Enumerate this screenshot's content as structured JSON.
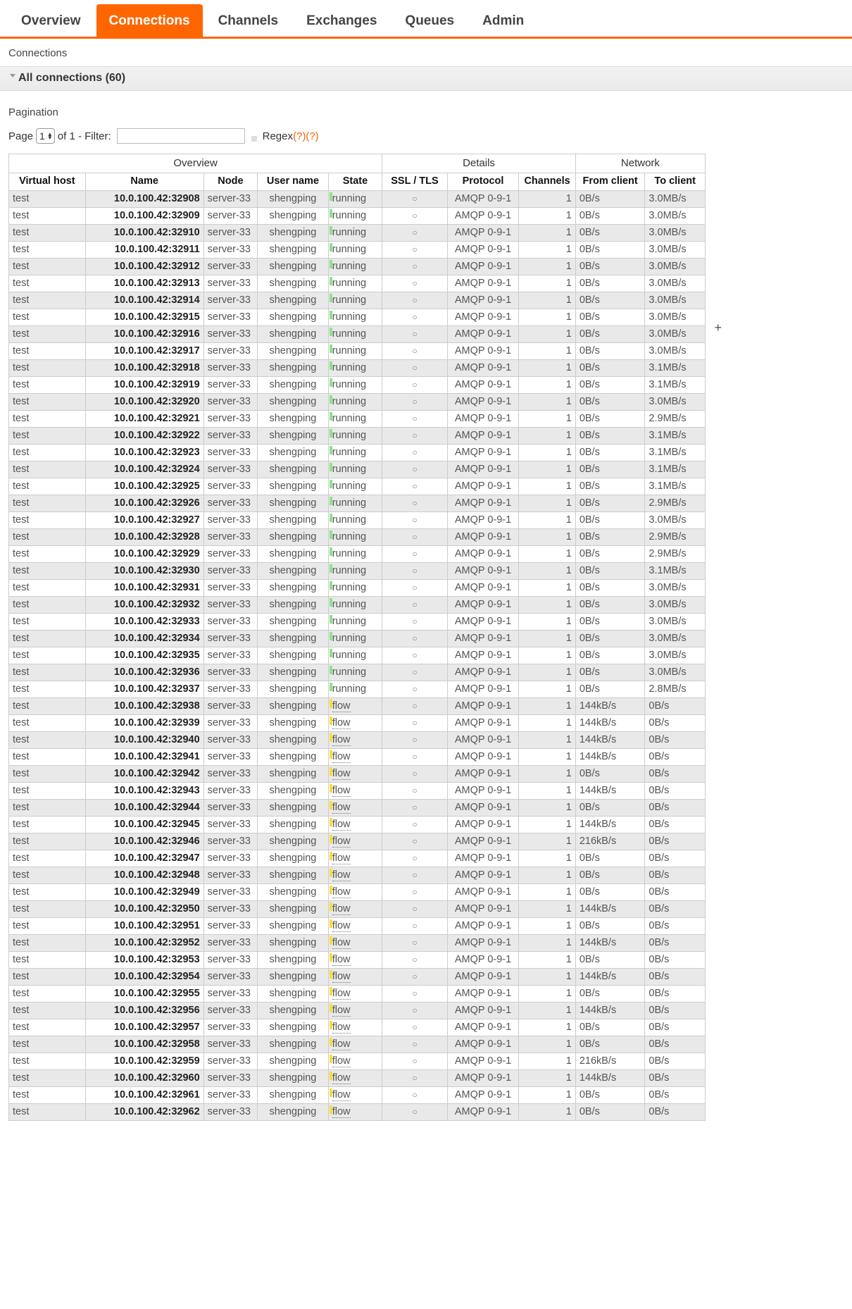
{
  "nav": {
    "tabs": [
      {
        "label": "Overview",
        "active": false
      },
      {
        "label": "Connections",
        "active": true
      },
      {
        "label": "Channels",
        "active": false
      },
      {
        "label": "Exchanges",
        "active": false
      },
      {
        "label": "Queues",
        "active": false
      },
      {
        "label": "Admin",
        "active": false
      }
    ],
    "accent_color": "#ff6600"
  },
  "breadcrumb": "Connections",
  "section": {
    "title": "All connections (60)",
    "count": 60
  },
  "pagination": {
    "label": "Pagination",
    "page_prefix": "Page",
    "page_value": "1",
    "of_text": "of 1 - Filter:",
    "filter_value": "",
    "filter_placeholder": "",
    "regex_label": "Regex",
    "help_1": "(?)",
    "help_2": "(?)",
    "regex_checked": false
  },
  "table": {
    "group_headers": [
      {
        "label": "Overview",
        "span": 5
      },
      {
        "label": "Details",
        "span": 3
      },
      {
        "label": "Network",
        "span": 2
      }
    ],
    "columns": [
      "Virtual host",
      "Name",
      "Node",
      "User name",
      "State",
      "SSL / TLS",
      "Protocol",
      "Channels",
      "From client",
      "To client"
    ],
    "add_column_icon": "+",
    "state_colors": {
      "running": "#8ee28e",
      "flow": "#f5e03d"
    },
    "rows": [
      [
        "test",
        "10.0.100.42:32908",
        "server-33",
        "shengping",
        "running",
        "○",
        "AMQP 0-9-1",
        "1",
        "0B/s",
        "3.0MB/s"
      ],
      [
        "test",
        "10.0.100.42:32909",
        "server-33",
        "shengping",
        "running",
        "○",
        "AMQP 0-9-1",
        "1",
        "0B/s",
        "3.0MB/s"
      ],
      [
        "test",
        "10.0.100.42:32910",
        "server-33",
        "shengping",
        "running",
        "○",
        "AMQP 0-9-1",
        "1",
        "0B/s",
        "3.0MB/s"
      ],
      [
        "test",
        "10.0.100.42:32911",
        "server-33",
        "shengping",
        "running",
        "○",
        "AMQP 0-9-1",
        "1",
        "0B/s",
        "3.0MB/s"
      ],
      [
        "test",
        "10.0.100.42:32912",
        "server-33",
        "shengping",
        "running",
        "○",
        "AMQP 0-9-1",
        "1",
        "0B/s",
        "3.0MB/s"
      ],
      [
        "test",
        "10.0.100.42:32913",
        "server-33",
        "shengping",
        "running",
        "○",
        "AMQP 0-9-1",
        "1",
        "0B/s",
        "3.0MB/s"
      ],
      [
        "test",
        "10.0.100.42:32914",
        "server-33",
        "shengping",
        "running",
        "○",
        "AMQP 0-9-1",
        "1",
        "0B/s",
        "3.0MB/s"
      ],
      [
        "test",
        "10.0.100.42:32915",
        "server-33",
        "shengping",
        "running",
        "○",
        "AMQP 0-9-1",
        "1",
        "0B/s",
        "3.0MB/s"
      ],
      [
        "test",
        "10.0.100.42:32916",
        "server-33",
        "shengping",
        "running",
        "○",
        "AMQP 0-9-1",
        "1",
        "0B/s",
        "3.0MB/s"
      ],
      [
        "test",
        "10.0.100.42:32917",
        "server-33",
        "shengping",
        "running",
        "○",
        "AMQP 0-9-1",
        "1",
        "0B/s",
        "3.0MB/s"
      ],
      [
        "test",
        "10.0.100.42:32918",
        "server-33",
        "shengping",
        "running",
        "○",
        "AMQP 0-9-1",
        "1",
        "0B/s",
        "3.1MB/s"
      ],
      [
        "test",
        "10.0.100.42:32919",
        "server-33",
        "shengping",
        "running",
        "○",
        "AMQP 0-9-1",
        "1",
        "0B/s",
        "3.1MB/s"
      ],
      [
        "test",
        "10.0.100.42:32920",
        "server-33",
        "shengping",
        "running",
        "○",
        "AMQP 0-9-1",
        "1",
        "0B/s",
        "3.0MB/s"
      ],
      [
        "test",
        "10.0.100.42:32921",
        "server-33",
        "shengping",
        "running",
        "○",
        "AMQP 0-9-1",
        "1",
        "0B/s",
        "2.9MB/s"
      ],
      [
        "test",
        "10.0.100.42:32922",
        "server-33",
        "shengping",
        "running",
        "○",
        "AMQP 0-9-1",
        "1",
        "0B/s",
        "3.1MB/s"
      ],
      [
        "test",
        "10.0.100.42:32923",
        "server-33",
        "shengping",
        "running",
        "○",
        "AMQP 0-9-1",
        "1",
        "0B/s",
        "3.1MB/s"
      ],
      [
        "test",
        "10.0.100.42:32924",
        "server-33",
        "shengping",
        "running",
        "○",
        "AMQP 0-9-1",
        "1",
        "0B/s",
        "3.1MB/s"
      ],
      [
        "test",
        "10.0.100.42:32925",
        "server-33",
        "shengping",
        "running",
        "○",
        "AMQP 0-9-1",
        "1",
        "0B/s",
        "3.1MB/s"
      ],
      [
        "test",
        "10.0.100.42:32926",
        "server-33",
        "shengping",
        "running",
        "○",
        "AMQP 0-9-1",
        "1",
        "0B/s",
        "2.9MB/s"
      ],
      [
        "test",
        "10.0.100.42:32927",
        "server-33",
        "shengping",
        "running",
        "○",
        "AMQP 0-9-1",
        "1",
        "0B/s",
        "3.0MB/s"
      ],
      [
        "test",
        "10.0.100.42:32928",
        "server-33",
        "shengping",
        "running",
        "○",
        "AMQP 0-9-1",
        "1",
        "0B/s",
        "2.9MB/s"
      ],
      [
        "test",
        "10.0.100.42:32929",
        "server-33",
        "shengping",
        "running",
        "○",
        "AMQP 0-9-1",
        "1",
        "0B/s",
        "2.9MB/s"
      ],
      [
        "test",
        "10.0.100.42:32930",
        "server-33",
        "shengping",
        "running",
        "○",
        "AMQP 0-9-1",
        "1",
        "0B/s",
        "3.1MB/s"
      ],
      [
        "test",
        "10.0.100.42:32931",
        "server-33",
        "shengping",
        "running",
        "○",
        "AMQP 0-9-1",
        "1",
        "0B/s",
        "3.0MB/s"
      ],
      [
        "test",
        "10.0.100.42:32932",
        "server-33",
        "shengping",
        "running",
        "○",
        "AMQP 0-9-1",
        "1",
        "0B/s",
        "3.0MB/s"
      ],
      [
        "test",
        "10.0.100.42:32933",
        "server-33",
        "shengping",
        "running",
        "○",
        "AMQP 0-9-1",
        "1",
        "0B/s",
        "3.0MB/s"
      ],
      [
        "test",
        "10.0.100.42:32934",
        "server-33",
        "shengping",
        "running",
        "○",
        "AMQP 0-9-1",
        "1",
        "0B/s",
        "3.0MB/s"
      ],
      [
        "test",
        "10.0.100.42:32935",
        "server-33",
        "shengping",
        "running",
        "○",
        "AMQP 0-9-1",
        "1",
        "0B/s",
        "3.0MB/s"
      ],
      [
        "test",
        "10.0.100.42:32936",
        "server-33",
        "shengping",
        "running",
        "○",
        "AMQP 0-9-1",
        "1",
        "0B/s",
        "3.0MB/s"
      ],
      [
        "test",
        "10.0.100.42:32937",
        "server-33",
        "shengping",
        "running",
        "○",
        "AMQP 0-9-1",
        "1",
        "0B/s",
        "2.8MB/s"
      ],
      [
        "test",
        "10.0.100.42:32938",
        "server-33",
        "shengping",
        "flow",
        "○",
        "AMQP 0-9-1",
        "1",
        "144kB/s",
        "0B/s"
      ],
      [
        "test",
        "10.0.100.42:32939",
        "server-33",
        "shengping",
        "flow",
        "○",
        "AMQP 0-9-1",
        "1",
        "144kB/s",
        "0B/s"
      ],
      [
        "test",
        "10.0.100.42:32940",
        "server-33",
        "shengping",
        "flow",
        "○",
        "AMQP 0-9-1",
        "1",
        "144kB/s",
        "0B/s"
      ],
      [
        "test",
        "10.0.100.42:32941",
        "server-33",
        "shengping",
        "flow",
        "○",
        "AMQP 0-9-1",
        "1",
        "144kB/s",
        "0B/s"
      ],
      [
        "test",
        "10.0.100.42:32942",
        "server-33",
        "shengping",
        "flow",
        "○",
        "AMQP 0-9-1",
        "1",
        "0B/s",
        "0B/s"
      ],
      [
        "test",
        "10.0.100.42:32943",
        "server-33",
        "shengping",
        "flow",
        "○",
        "AMQP 0-9-1",
        "1",
        "144kB/s",
        "0B/s"
      ],
      [
        "test",
        "10.0.100.42:32944",
        "server-33",
        "shengping",
        "flow",
        "○",
        "AMQP 0-9-1",
        "1",
        "0B/s",
        "0B/s"
      ],
      [
        "test",
        "10.0.100.42:32945",
        "server-33",
        "shengping",
        "flow",
        "○",
        "AMQP 0-9-1",
        "1",
        "144kB/s",
        "0B/s"
      ],
      [
        "test",
        "10.0.100.42:32946",
        "server-33",
        "shengping",
        "flow",
        "○",
        "AMQP 0-9-1",
        "1",
        "216kB/s",
        "0B/s"
      ],
      [
        "test",
        "10.0.100.42:32947",
        "server-33",
        "shengping",
        "flow",
        "○",
        "AMQP 0-9-1",
        "1",
        "0B/s",
        "0B/s"
      ],
      [
        "test",
        "10.0.100.42:32948",
        "server-33",
        "shengping",
        "flow",
        "○",
        "AMQP 0-9-1",
        "1",
        "0B/s",
        "0B/s"
      ],
      [
        "test",
        "10.0.100.42:32949",
        "server-33",
        "shengping",
        "flow",
        "○",
        "AMQP 0-9-1",
        "1",
        "0B/s",
        "0B/s"
      ],
      [
        "test",
        "10.0.100.42:32950",
        "server-33",
        "shengping",
        "flow",
        "○",
        "AMQP 0-9-1",
        "1",
        "144kB/s",
        "0B/s"
      ],
      [
        "test",
        "10.0.100.42:32951",
        "server-33",
        "shengping",
        "flow",
        "○",
        "AMQP 0-9-1",
        "1",
        "0B/s",
        "0B/s"
      ],
      [
        "test",
        "10.0.100.42:32952",
        "server-33",
        "shengping",
        "flow",
        "○",
        "AMQP 0-9-1",
        "1",
        "144kB/s",
        "0B/s"
      ],
      [
        "test",
        "10.0.100.42:32953",
        "server-33",
        "shengping",
        "flow",
        "○",
        "AMQP 0-9-1",
        "1",
        "0B/s",
        "0B/s"
      ],
      [
        "test",
        "10.0.100.42:32954",
        "server-33",
        "shengping",
        "flow",
        "○",
        "AMQP 0-9-1",
        "1",
        "144kB/s",
        "0B/s"
      ],
      [
        "test",
        "10.0.100.42:32955",
        "server-33",
        "shengping",
        "flow",
        "○",
        "AMQP 0-9-1",
        "1",
        "0B/s",
        "0B/s"
      ],
      [
        "test",
        "10.0.100.42:32956",
        "server-33",
        "shengping",
        "flow",
        "○",
        "AMQP 0-9-1",
        "1",
        "144kB/s",
        "0B/s"
      ],
      [
        "test",
        "10.0.100.42:32957",
        "server-33",
        "shengping",
        "flow",
        "○",
        "AMQP 0-9-1",
        "1",
        "0B/s",
        "0B/s"
      ],
      [
        "test",
        "10.0.100.42:32958",
        "server-33",
        "shengping",
        "flow",
        "○",
        "AMQP 0-9-1",
        "1",
        "0B/s",
        "0B/s"
      ],
      [
        "test",
        "10.0.100.42:32959",
        "server-33",
        "shengping",
        "flow",
        "○",
        "AMQP 0-9-1",
        "1",
        "216kB/s",
        "0B/s"
      ],
      [
        "test",
        "10.0.100.42:32960",
        "server-33",
        "shengping",
        "flow",
        "○",
        "AMQP 0-9-1",
        "1",
        "144kB/s",
        "0B/s"
      ],
      [
        "test",
        "10.0.100.42:32961",
        "server-33",
        "shengping",
        "flow",
        "○",
        "AMQP 0-9-1",
        "1",
        "0B/s",
        "0B/s"
      ],
      [
        "test",
        "10.0.100.42:32962",
        "server-33",
        "shengping",
        "flow",
        "○",
        "AMQP 0-9-1",
        "1",
        "0B/s",
        "0B/s"
      ]
    ]
  }
}
